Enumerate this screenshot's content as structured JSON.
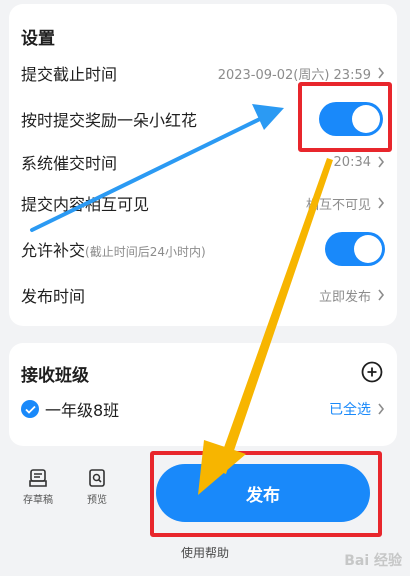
{
  "settings": {
    "title": "设置",
    "deadline": {
      "label": "提交截止时间",
      "value": "2023-09-02(周六) 23:59"
    },
    "flower": {
      "label": "按时提交奖励一朵小红花",
      "enabled": true
    },
    "reminder": {
      "label": "系统催交时间",
      "value": "20:34"
    },
    "visibility": {
      "label": "提交内容相互可见",
      "value": "相互不可见"
    },
    "late": {
      "label": "允许补交",
      "hint": "(截止时间后24小时内)",
      "enabled": true
    },
    "publish_time": {
      "label": "发布时间",
      "value": "立即发布"
    }
  },
  "classes": {
    "title": "接收班级",
    "add_icon": "plus-circle-icon",
    "selected": "一年级8班",
    "select_all": "已全选"
  },
  "bottom": {
    "draft_label": "存草稿",
    "preview_label": "预览",
    "publish_label": "发布",
    "help_label": "使用帮助"
  },
  "watermark": "Bai 经验",
  "colors": {
    "accent": "#1989fa",
    "highlight": "#e8262c",
    "arrow_blue": "#2b9af3",
    "arrow_orange": "#f7b500"
  }
}
